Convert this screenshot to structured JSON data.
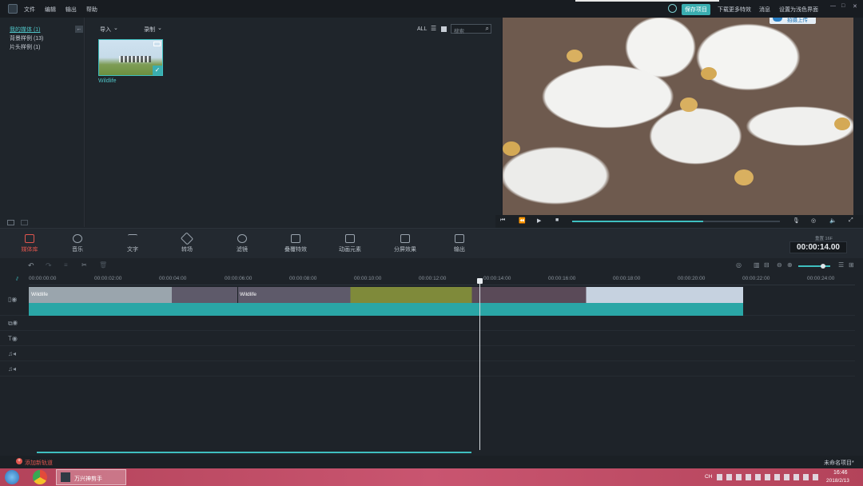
{
  "menu": [
    "文件",
    "编辑",
    "输出",
    "帮助"
  ],
  "title_right": {
    "save_project": "保存项目",
    "download_effects": "下载更多特效",
    "messages": "消息",
    "simple_mode": "设置为浅色界面",
    "upload": "拍摄上传"
  },
  "media_tree": {
    "my_media": "我的媒体 (1)",
    "bg_samples": "背景样例 (13)",
    "intro_samples": "片头样例 (1)"
  },
  "media_toolbar": {
    "import": "导入",
    "record": "录制",
    "all": "ALL",
    "search_placeholder": "搜索"
  },
  "media_item": {
    "name": "Wildlife"
  },
  "tools": [
    {
      "label": "媒体库"
    },
    {
      "label": "音乐"
    },
    {
      "label": "文字"
    },
    {
      "label": "转场"
    },
    {
      "label": "滤镜"
    },
    {
      "label": "叠覆特效"
    },
    {
      "label": "动画元素"
    },
    {
      "label": "分屏效果"
    },
    {
      "label": "输出"
    }
  ],
  "timecode": {
    "label": "重置",
    "value": "00:00:14.00",
    "fps": "16F"
  },
  "ruler": [
    "00:00:00:00",
    "00:00:02:00",
    "00:00:04:00",
    "00:00:06:00",
    "00:00:08:00",
    "00:00:10:00",
    "00:00:12:00",
    "00:00:14:00",
    "00:00:16:00",
    "00:00:18:00",
    "00:00:20:00",
    "00:00:22:00",
    "00:00:24:00"
  ],
  "clip_labels": [
    "Wildlife",
    "Wildlife"
  ],
  "status": {
    "add_track": "添加新轨道",
    "project_name": "未命名项目*"
  },
  "taskbar": {
    "app": "万兴神剪手",
    "time": "16:46",
    "date": "2018/2/13",
    "lang": "CH"
  },
  "colors": {
    "accent": "#3fbfbf",
    "active_tool": "#e0564e",
    "clip_audio": "#2aa6a6"
  }
}
